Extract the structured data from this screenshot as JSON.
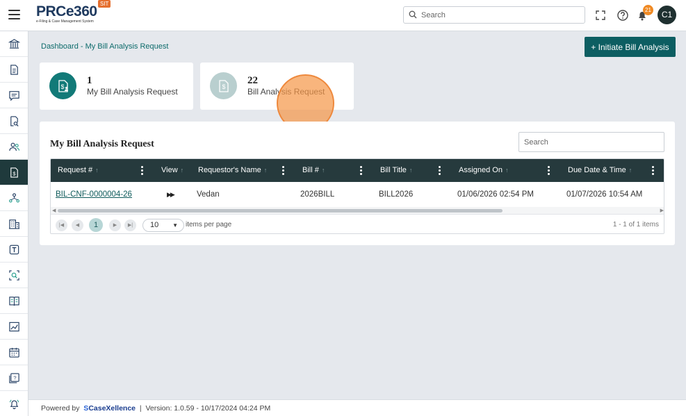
{
  "header": {
    "logo_text": "PRCe360",
    "logo_subtitle": "e-Filing & Case Management System",
    "env_badge": "SIT",
    "search_placeholder": "Search",
    "notification_count": "21",
    "avatar_initials": "C1"
  },
  "sidebar": {
    "items": [
      {
        "icon": "bank-icon",
        "active": false
      },
      {
        "icon": "document-icon",
        "active": false
      },
      {
        "icon": "chat-icon",
        "active": false
      },
      {
        "icon": "document-search-icon",
        "active": false
      },
      {
        "icon": "users-icon",
        "active": false
      },
      {
        "icon": "bill-dollar-icon",
        "active": true
      },
      {
        "icon": "org-network-icon",
        "active": false
      },
      {
        "icon": "building-icon",
        "active": false
      },
      {
        "icon": "text-template-icon",
        "active": false
      },
      {
        "icon": "scan-search-icon",
        "active": false
      },
      {
        "icon": "book-icon",
        "active": false
      },
      {
        "icon": "chart-icon",
        "active": false
      },
      {
        "icon": "calendar-icon",
        "active": false
      },
      {
        "icon": "help-doc-icon",
        "active": false
      },
      {
        "icon": "bell-alert-icon",
        "active": false
      }
    ]
  },
  "breadcrumb": "Dashboard - My Bill Analysis Request",
  "initiate_button": "+ Initiate Bill Analysis",
  "cards": [
    {
      "count": "1",
      "label": "My Bill Analysis Request"
    },
    {
      "count": "22",
      "label": "Bill Analysis Request"
    }
  ],
  "panel": {
    "title": "My Bill Analysis Request",
    "search_placeholder": "Search",
    "columns": [
      "Request #",
      "View",
      "Requestor's Name",
      "Bill #",
      "Bill Title",
      "Assigned On",
      "Due Date & Time"
    ],
    "rows": [
      {
        "request_no": "BIL-CNF-0000004-26",
        "view_icon": "fast-forward-icon",
        "requestor": "Vedan",
        "bill_no": "2026BILL",
        "bill_title": "BILL2026",
        "assigned_on": "01/06/2026 02:54 PM",
        "due": "01/07/2026 10:54 AM"
      }
    ],
    "pager": {
      "current_page": "1",
      "page_size": "10",
      "page_size_label": "items per page",
      "info": "1 - 1 of 1 items"
    }
  },
  "footer": {
    "powered_by": "Powered by",
    "brand": "CaseXellence",
    "version": "Version: 1.0.59 - 10/17/2024 04:24 PM"
  },
  "colors": {
    "primary": "#0d5e62",
    "header_dark": "#263a3d",
    "accent_orange": "#f08a24"
  }
}
